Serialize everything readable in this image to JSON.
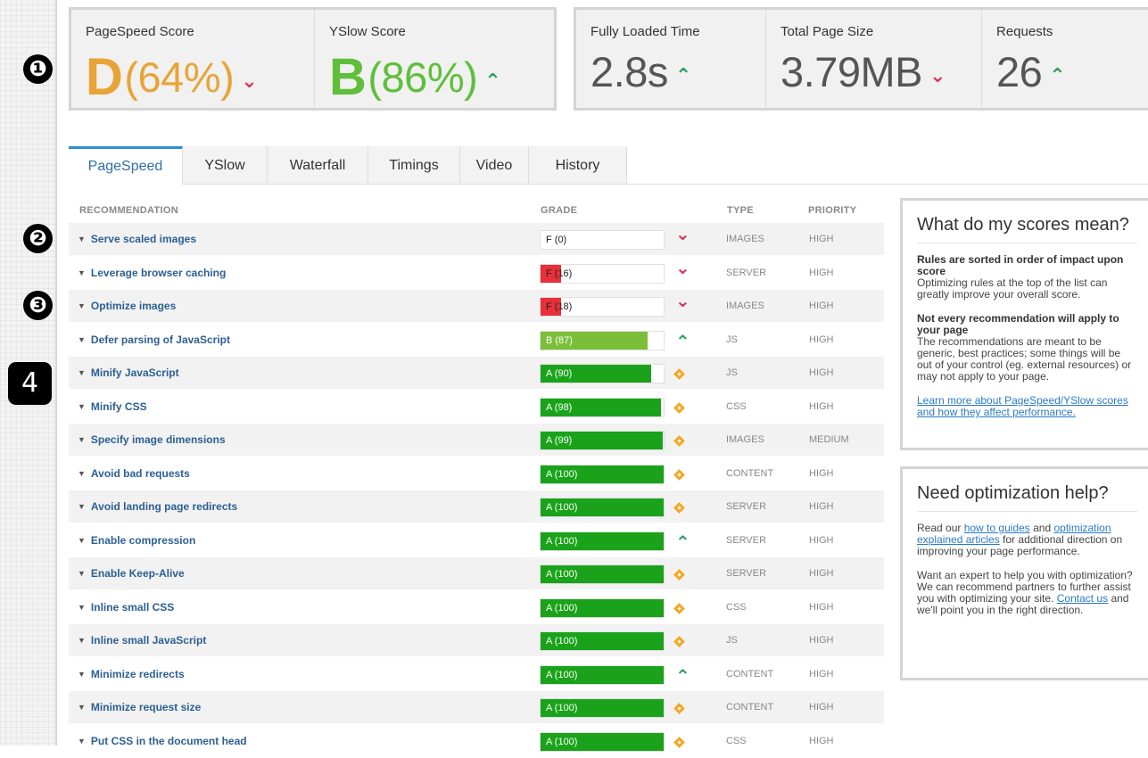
{
  "markers": [
    "❶",
    "❷",
    "❸",
    "4"
  ],
  "scores": {
    "pagespeed": {
      "label": "PageSpeed Score",
      "letter": "D",
      "pct": "(64%)",
      "trend": "down"
    },
    "yslow": {
      "label": "YSlow Score",
      "letter": "B",
      "pct": "(86%)",
      "trend": "up"
    },
    "loaded": {
      "label": "Fully Loaded Time",
      "value": "2.8s",
      "trend": "up"
    },
    "size": {
      "label": "Total Page Size",
      "value": "3.79MB",
      "trend": "down"
    },
    "requests": {
      "label": "Requests",
      "value": "26",
      "trend": "up"
    }
  },
  "tabs": [
    "PageSpeed",
    "YSlow",
    "Waterfall",
    "Timings",
    "Video",
    "History"
  ],
  "active_tab": "PageSpeed",
  "table": {
    "headers": {
      "recommendation": "RECOMMENDATION",
      "grade": "GRADE",
      "type": "TYPE",
      "priority": "PRIORITY"
    },
    "rows": [
      {
        "name": "Serve scaled images",
        "grade": "F (0)",
        "score": 0,
        "icon": "down",
        "type": "IMAGES",
        "priority": "HIGH"
      },
      {
        "name": "Leverage browser caching",
        "grade": "F (16)",
        "score": 16,
        "icon": "down",
        "type": "SERVER",
        "priority": "HIGH"
      },
      {
        "name": "Optimize images",
        "grade": "F (18)",
        "score": 18,
        "icon": "down",
        "type": "IMAGES",
        "priority": "HIGH"
      },
      {
        "name": "Defer parsing of JavaScript",
        "grade": "B (87)",
        "score": 87,
        "icon": "up",
        "type": "JS",
        "priority": "HIGH"
      },
      {
        "name": "Minify JavaScript",
        "grade": "A (90)",
        "score": 90,
        "icon": "diamond",
        "type": "JS",
        "priority": "HIGH"
      },
      {
        "name": "Minify CSS",
        "grade": "A (98)",
        "score": 98,
        "icon": "diamond",
        "type": "CSS",
        "priority": "HIGH"
      },
      {
        "name": "Specify image dimensions",
        "grade": "A (99)",
        "score": 99,
        "icon": "diamond",
        "type": "IMAGES",
        "priority": "MEDIUM"
      },
      {
        "name": "Avoid bad requests",
        "grade": "A (100)",
        "score": 100,
        "icon": "diamond",
        "type": "CONTENT",
        "priority": "HIGH"
      },
      {
        "name": "Avoid landing page redirects",
        "grade": "A (100)",
        "score": 100,
        "icon": "diamond",
        "type": "SERVER",
        "priority": "HIGH"
      },
      {
        "name": "Enable compression",
        "grade": "A (100)",
        "score": 100,
        "icon": "up",
        "type": "SERVER",
        "priority": "HIGH"
      },
      {
        "name": "Enable Keep-Alive",
        "grade": "A (100)",
        "score": 100,
        "icon": "diamond",
        "type": "SERVER",
        "priority": "HIGH"
      },
      {
        "name": "Inline small CSS",
        "grade": "A (100)",
        "score": 100,
        "icon": "diamond",
        "type": "CSS",
        "priority": "HIGH"
      },
      {
        "name": "Inline small JavaScript",
        "grade": "A (100)",
        "score": 100,
        "icon": "diamond",
        "type": "JS",
        "priority": "HIGH"
      },
      {
        "name": "Minimize redirects",
        "grade": "A (100)",
        "score": 100,
        "icon": "up",
        "type": "CONTENT",
        "priority": "HIGH"
      },
      {
        "name": "Minimize request size",
        "grade": "A (100)",
        "score": 100,
        "icon": "diamond",
        "type": "CONTENT",
        "priority": "HIGH"
      },
      {
        "name": "Put CSS in the document head",
        "grade": "A (100)",
        "score": 100,
        "icon": "diamond",
        "type": "CSS",
        "priority": "HIGH"
      }
    ]
  },
  "sidebar": {
    "scores_box": {
      "title": "What do my scores mean?",
      "h1": "Rules are sorted in order of impact upon score",
      "p1": "Optimizing rules at the top of the list can greatly improve your overall score.",
      "h2": "Not every recommendation will apply to your page",
      "p2": "The recommendations are meant to be generic, best practices; some things will be out of your control (eg. external resources) or may not apply to your page.",
      "link": "Learn more about PageSpeed/YSlow scores and how they affect performance."
    },
    "help_box": {
      "title": "Need optimization help?",
      "p1_a": "Read our ",
      "p1_link1": "how to guides",
      "p1_b": " and ",
      "p1_link2": "optimization explained articles",
      "p1_c": " for additional direction on improving your page performance.",
      "p2_a": "Want an expert to help you with optimization? We can recommend partners to further assist you with optimizing your site. ",
      "p2_link": "Contact us",
      "p2_b": " and we'll point you in the right direction."
    }
  },
  "colors": {
    "grade_f": "#e8303a",
    "grade_b": "#7bbf38",
    "grade_a": "#1aa31a",
    "link": "#2c5f93",
    "arrow_up": "#2a9f5a",
    "arrow_down": "#d9325a",
    "diamond": "#f5a623"
  }
}
